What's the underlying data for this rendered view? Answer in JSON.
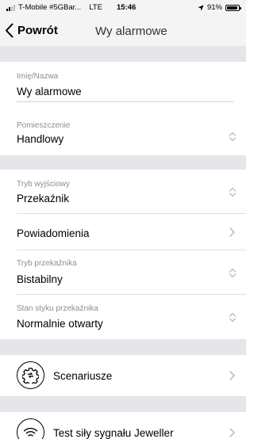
{
  "status_bar": {
    "carrier": "T-Mobile #5GBar...",
    "network": "LTE",
    "time": "15:46",
    "battery": "91%",
    "battery_level": 0.91
  },
  "nav": {
    "back_label": "Powrót",
    "title": "Wy alarmowe"
  },
  "form": {
    "name": {
      "label": "Imię/Nazwa",
      "value": "Wy alarmowe"
    },
    "room": {
      "label": "Pomieszczenie",
      "value": "Handlowy"
    },
    "output_mode": {
      "label": "Tryb wyjściowy",
      "value": "Przekaźnik"
    },
    "notifications": {
      "label": "Powiadomienia"
    },
    "relay_mode": {
      "label": "Tryb przekaźnika",
      "value": "Bistabilny"
    },
    "contact_state": {
      "label": "Stan styku przekaźnika",
      "value": "Normalnie otwarty"
    }
  },
  "actions": {
    "scenarios": {
      "label": "Scenariusze",
      "icon": "scenario-gear-icon"
    },
    "signal_test": {
      "label": "Test siły sygnału Jeweller",
      "icon": "wifi-signal-icon"
    }
  },
  "colors": {
    "background": "#ffffff",
    "section_gap": "#e5e5ea",
    "bar_background": "#f4f4f4",
    "secondary_text": "#8e8e93",
    "separator": "#e0e0e0"
  }
}
